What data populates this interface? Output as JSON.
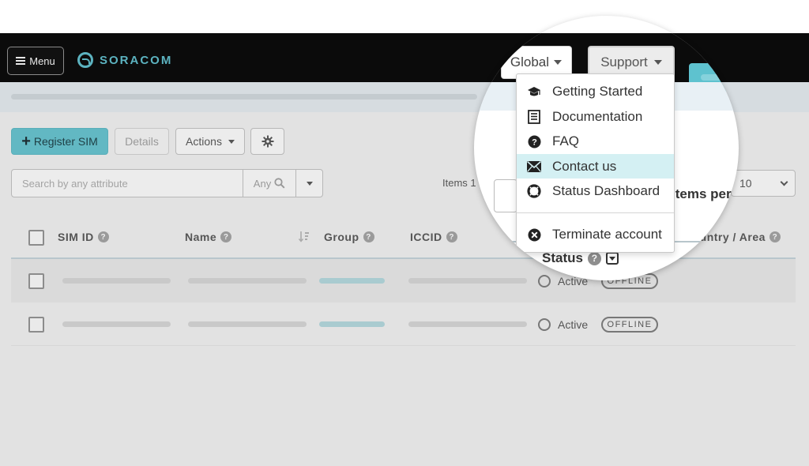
{
  "navbar": {
    "menu_label": "Menu",
    "brand": "SORACOM",
    "global_label": "Global",
    "support_label": "Support"
  },
  "toolbar": {
    "register_label": "Register SIM",
    "details_label": "Details",
    "actions_label": "Actions"
  },
  "search": {
    "placeholder": "Search by any attribute",
    "scope_label": "Any"
  },
  "pagination": {
    "items_label": "Items 1",
    "per_page_label": "items per",
    "per_page_value": "10"
  },
  "table": {
    "headers": {
      "sim_id": "SIM ID",
      "name": "Name",
      "group": "Group",
      "iccid": "ICCID",
      "status": "Status",
      "country": "Country / Area"
    },
    "rows": [
      {
        "status": "Active",
        "badge": "OFFLINE"
      },
      {
        "status": "Active",
        "badge": "OFFLINE"
      }
    ]
  },
  "support_menu": {
    "items": [
      {
        "label": "Getting Started",
        "icon": "graduation-cap-icon"
      },
      {
        "label": "Documentation",
        "icon": "document-list-icon"
      },
      {
        "label": "FAQ",
        "icon": "question-circle-icon"
      },
      {
        "label": "Contact us",
        "icon": "envelope-icon"
      },
      {
        "label": "Status Dashboard",
        "icon": "life-ring-icon"
      },
      {
        "label": "Terminate account",
        "icon": "close-circle-icon"
      }
    ],
    "active_index": 3
  },
  "colors": {
    "accent": "#62b8c3",
    "navbar": "#0b0b0b",
    "highlight": "#d4f0f3"
  }
}
